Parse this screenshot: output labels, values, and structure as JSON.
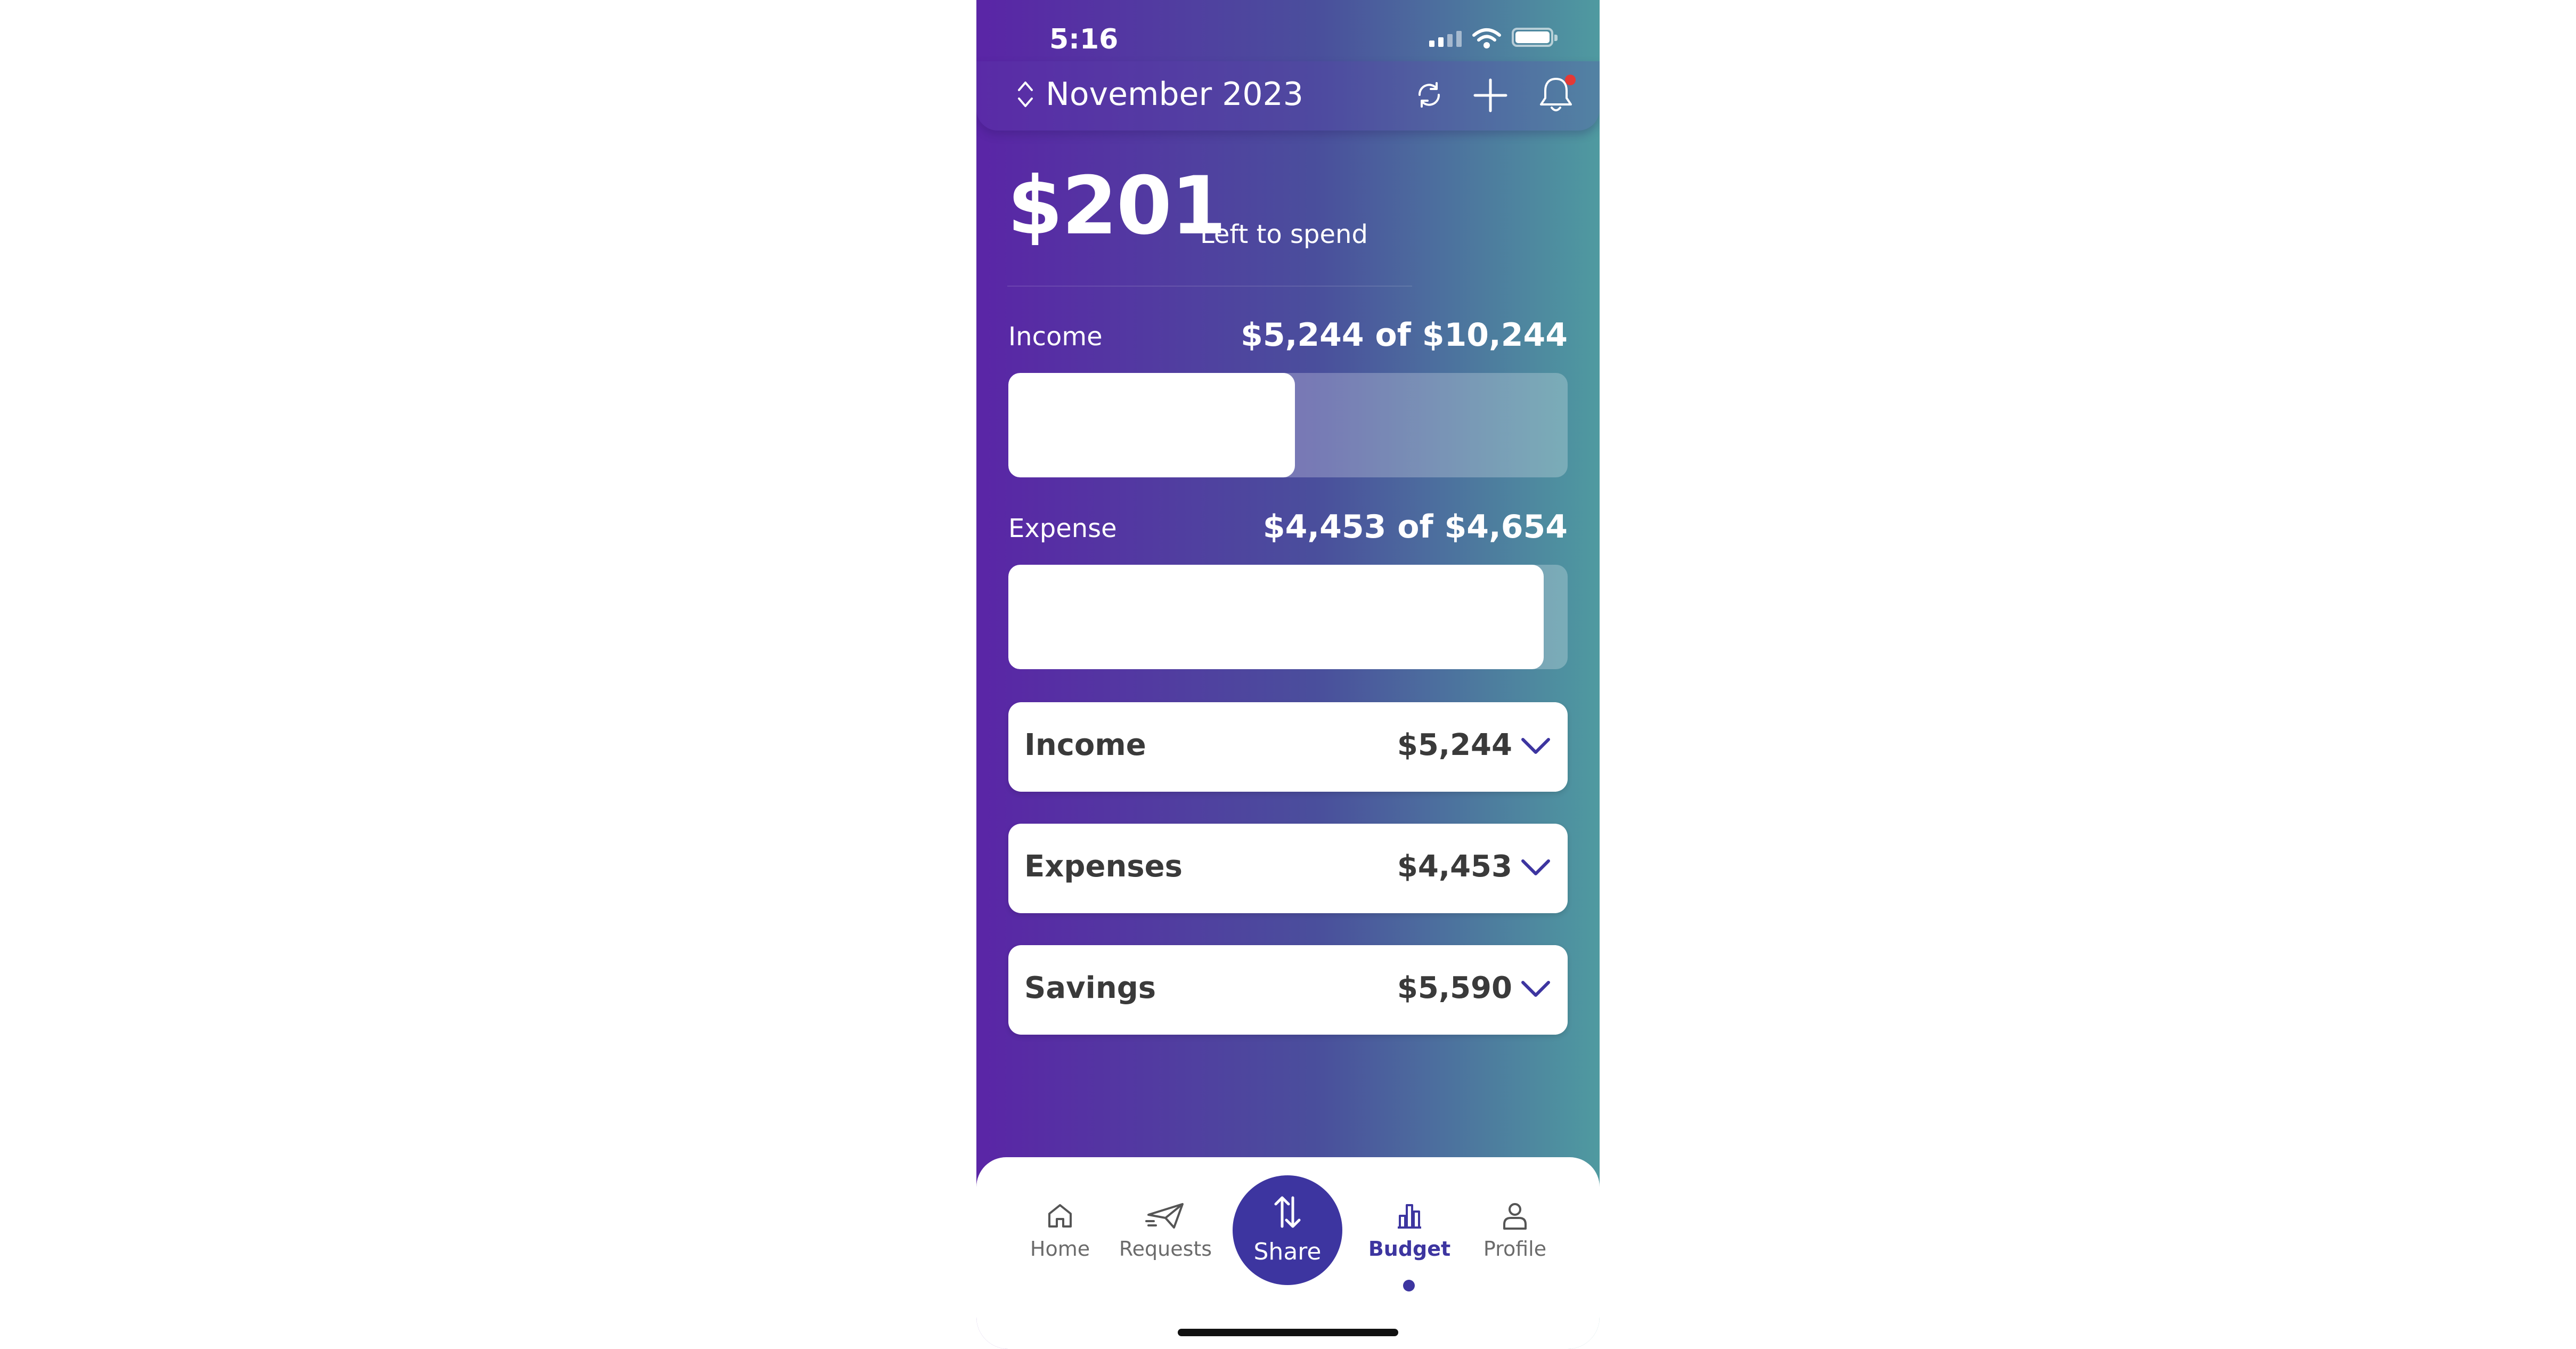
{
  "status_bar": {
    "time": "5:16"
  },
  "header": {
    "month": "November 2023",
    "icons": [
      "sort-chevrons-icon",
      "sync-icon",
      "plus-icon",
      "bell-icon"
    ]
  },
  "summary": {
    "amount": "$201",
    "label": "Left to spend"
  },
  "progress": {
    "income": {
      "label": "Income",
      "value_text": "$5,244 of $10,244",
      "fraction": 0.512
    },
    "expense": {
      "label": "Expense",
      "value_text": "$4,453 of $4,654",
      "fraction": 0.957
    }
  },
  "categories": [
    {
      "title": "Income",
      "amount": "$5,244"
    },
    {
      "title": "Expenses",
      "amount": "$4,453"
    },
    {
      "title": "Savings",
      "amount": "$5,590"
    }
  ],
  "nav": {
    "items": [
      {
        "label": "Home",
        "icon": "home-icon"
      },
      {
        "label": "Requests",
        "icon": "send-icon"
      },
      {
        "label": "Share",
        "icon": "transfer-arrows-icon"
      },
      {
        "label": "Budget",
        "icon": "bar-chart-icon",
        "active": true
      },
      {
        "label": "Profile",
        "icon": "person-icon"
      }
    ]
  },
  "colors": {
    "accent": "#3d35a0",
    "gradient_start": "#5a25a6",
    "gradient_end": "#4f9aa0",
    "notification": "#e53935"
  }
}
